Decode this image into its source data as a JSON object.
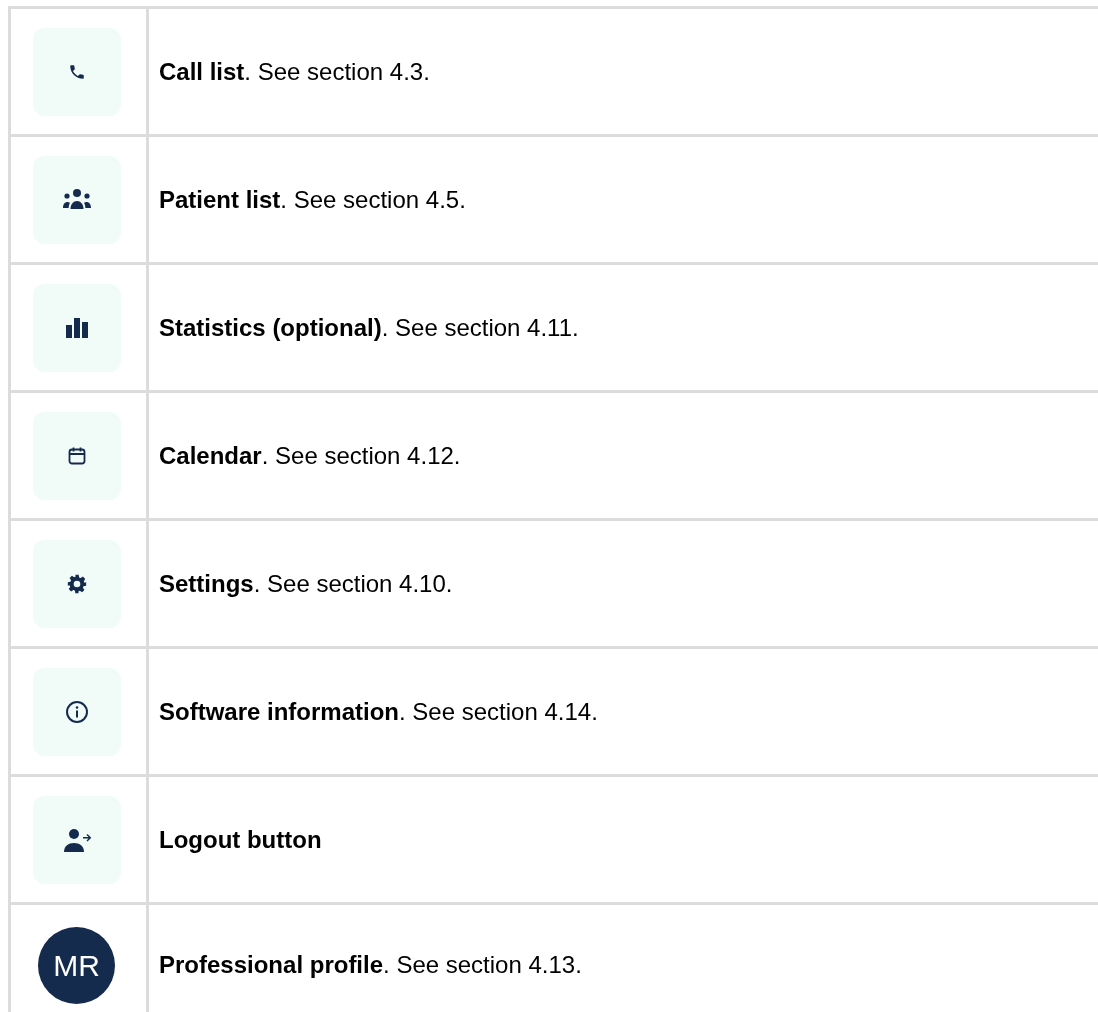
{
  "rows": [
    {
      "kind": "icon",
      "title": "Call list",
      "rest": ". See section 4.3."
    },
    {
      "kind": "icon",
      "title": "Patient list",
      "rest": ". See section 4.5."
    },
    {
      "kind": "icon",
      "title": "Statistics (optional)",
      "rest": ". See section 4.11."
    },
    {
      "kind": "icon",
      "title": "Calendar",
      "rest": ". See section 4.12."
    },
    {
      "kind": "icon",
      "title": "Settings",
      "rest": ". See section 4.10."
    },
    {
      "kind": "icon",
      "title": "Software information",
      "rest": ". See section 4.14."
    },
    {
      "kind": "icon",
      "title": "Logout button"
    },
    {
      "kind": "avatar",
      "initials": "MR",
      "title": "Professional profile",
      "rest": ". See section 4.13."
    }
  ]
}
